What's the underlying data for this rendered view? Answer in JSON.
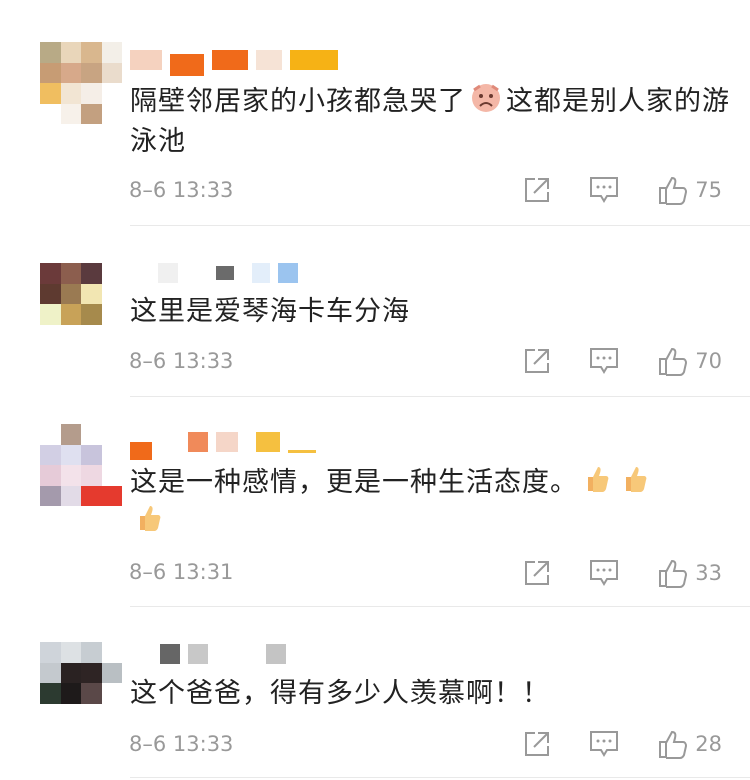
{
  "comments": [
    {
      "text_before": "隔壁邻居家的小孩都急哭了",
      "emoji_1": "sad-face-emoji",
      "text_after": "这都是别人家的游泳池",
      "time": "8–6 13:33",
      "likes": "75"
    },
    {
      "text": "这里是爱琴海卡车分海",
      "time": "8–6 13:33",
      "likes": "70"
    },
    {
      "text": "这是一种感情，更是一种生活态度。",
      "emoji": "thumbs-up-emoji",
      "time": "8–6 13:31",
      "likes": "33"
    },
    {
      "text": "这个爸爸，得有多少人羡慕啊！！",
      "time": "8–6 13:33",
      "likes": "28"
    }
  ],
  "colors": {
    "text": "#222222",
    "meta": "#999999",
    "divider": "#e9e9e9"
  }
}
